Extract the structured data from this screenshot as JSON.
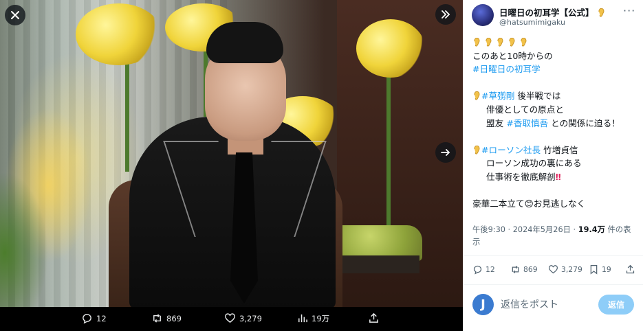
{
  "media": {
    "close_icon": "close-icon",
    "expand_icon": "double-chevron-right-icon",
    "next_icon": "arrow-right-icon"
  },
  "actionbar": {
    "replies": "12",
    "reposts": "869",
    "likes": "3,279",
    "views": "19万"
  },
  "tweet": {
    "account_name": "日曜日の初耳学【公式】",
    "handle": "@hatsumimigaku",
    "lines": {
      "l2": "このあと10時からの",
      "l3_tag": "#日曜日の初耳学",
      "l5_tag": "#草彅剛",
      "l5_rest": " 後半戦では",
      "l6": "俳優としての原点と",
      "l7_pre": "盟友 ",
      "l7_tag": "#香取慎吾",
      "l7_rest": " との関係に迫る！",
      "l9_tag": "#ローソン社長",
      "l9_rest": " 竹増貞信",
      "l10": "ローソン成功の裏にある",
      "l11": "仕事術を徹底解剖",
      "l11_mark": "‼",
      "l13": "豪華二本立て",
      "l13_emoji": "😊",
      "l13_rest": "お見逃しなく"
    },
    "meta_time": "午後9:30 · 2024年5月26日 · ",
    "meta_views": "19.4万",
    "meta_views_suffix": " 件の表",
    "meta_line2": "示"
  },
  "stats": {
    "replies": "12",
    "reposts": "869",
    "likes": "3,279",
    "bookmarks": "19"
  },
  "reply": {
    "avatar_letter": "J",
    "placeholder": "返信をポスト",
    "button": "返信"
  },
  "colors": {
    "link": "#1d9bf0",
    "muted": "#536471",
    "reply_button": "#8ecdf8"
  }
}
